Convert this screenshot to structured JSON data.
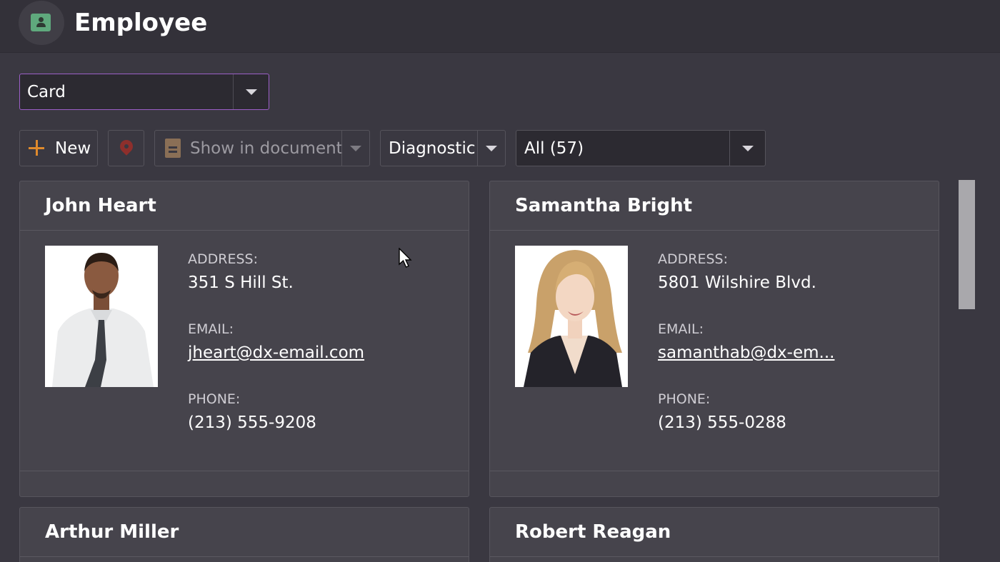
{
  "header": {
    "title": "Employee",
    "icon": "employee-card-icon"
  },
  "view_selector": {
    "value": "Card"
  },
  "toolbar": {
    "new_label": "New",
    "show_in_document_label": "Show in document",
    "diagnostic_label": "Diagnostic",
    "filter_value": "All (57)"
  },
  "labels": {
    "address": "ADDRESS:",
    "email": "EMAIL:",
    "phone": "PHONE:"
  },
  "cards": [
    {
      "name": "John Heart",
      "address": "351 S Hill St.",
      "email": "jheart@dx-email.com",
      "phone": "(213) 555-9208"
    },
    {
      "name": "Samantha Bright",
      "address": "5801 Wilshire Blvd.",
      "email": "samanthab@dx-em...",
      "phone": "(213) 555-0288"
    },
    {
      "name": "Arthur Miller"
    },
    {
      "name": "Robert Reagan"
    }
  ],
  "colors": {
    "accent": "#9b5fc7",
    "new_icon": "#e08a2c",
    "pin_icon": "#8e2f2c",
    "app_icon": "#5fa97d"
  }
}
